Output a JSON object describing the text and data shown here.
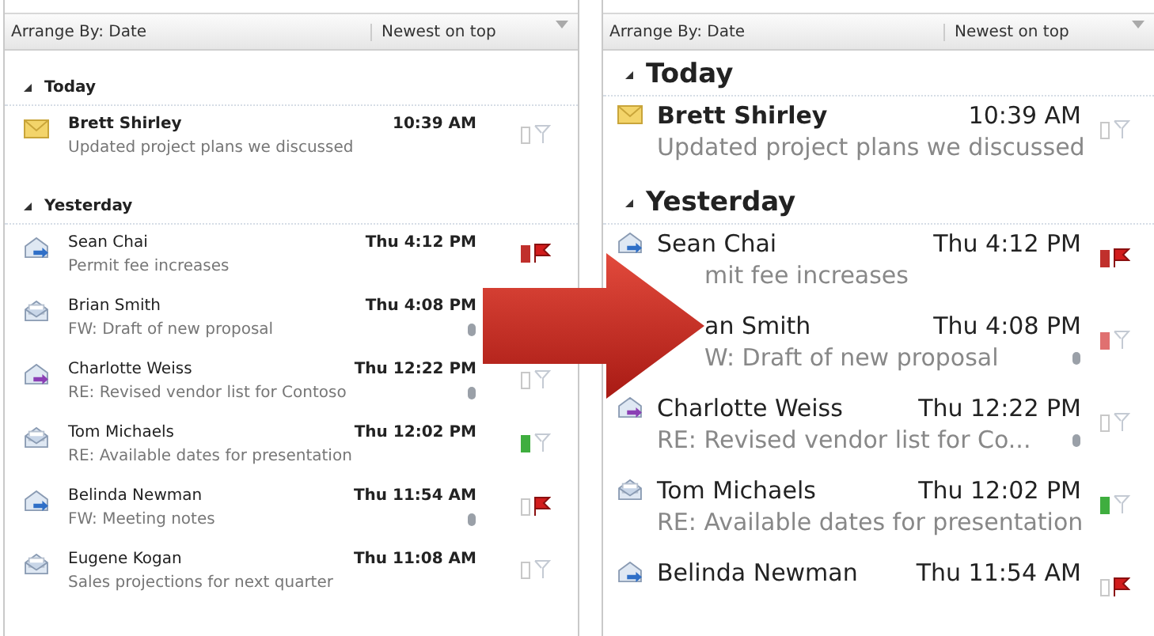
{
  "panels": [
    {
      "kind": "small",
      "header": {
        "arrange": "Arrange By: Date",
        "order": "Newest on top"
      },
      "groups": [
        {
          "label": "Today",
          "messages": [
            {
              "kind": "unread",
              "from": "Brett Shirley",
              "time": "10:39 AM",
              "subject": "Updated project plans we discussed",
              "unread": true,
              "flagged": false
            }
          ]
        },
        {
          "label": "Yesterday",
          "messages": [
            {
              "kind": "replied",
              "from": "Sean Chai",
              "time": "Thu 4:12 PM",
              "subject": "Permit fee increases",
              "unread": false,
              "color": "#c0302c",
              "flagged": true
            },
            {
              "kind": "read",
              "from": "Brian Smith",
              "time": "Thu 4:08 PM",
              "subject": "FW: Draft of new proposal",
              "unread": false,
              "attachment": true
            },
            {
              "kind": "forwarded",
              "from": "Charlotte Weiss",
              "time": "Thu 12:22 PM",
              "subject": "RE: Revised vendor list for Contoso",
              "unread": false,
              "attachment": true,
              "flagged": false
            },
            {
              "kind": "read",
              "from": "Tom Michaels",
              "time": "Thu 12:02 PM",
              "subject": "RE: Available dates for presentation",
              "unread": false,
              "color": "#3fae3f",
              "flagged": false
            },
            {
              "kind": "replied",
              "from": "Belinda Newman",
              "time": "Thu 11:54 AM",
              "subject": "FW: Meeting notes",
              "unread": false,
              "attachment": true,
              "flagged": true
            },
            {
              "kind": "read",
              "from": "Eugene Kogan",
              "time": "Thu 11:08 AM",
              "subject": "Sales projections for next quarter",
              "unread": false,
              "flagged": false
            }
          ]
        }
      ]
    },
    {
      "kind": "large",
      "header": {
        "arrange": "Arrange By: Date",
        "order": "Newest on top"
      },
      "groups": [
        {
          "label": "Today",
          "messages": [
            {
              "kind": "unread",
              "from": "Brett Shirley",
              "time": "10:39 AM",
              "subject": "Updated project plans we discussed",
              "unread": true,
              "flagged": false
            }
          ]
        },
        {
          "label": "Yesterday",
          "messages": [
            {
              "kind": "replied",
              "from": "Sean Chai",
              "time": "Thu 4:12 PM",
              "subject": "mit fee increases",
              "subject_hidden_start": true,
              "unread": false,
              "color": "#c0302c",
              "flagged": true
            },
            {
              "kind": "hidden",
              "from": "an Smith",
              "from_hidden_start": true,
              "time": "Thu 4:08 PM",
              "subject": "W: Draft of new proposal",
              "subject_hidden_start": true,
              "unread": false,
              "attachment": true,
              "color": "#e07070",
              "flagged": false
            },
            {
              "kind": "forwarded",
              "from": "Charlotte Weiss",
              "time": "Thu 12:22 PM",
              "subject": "RE: Revised vendor list for Co...",
              "unread": false,
              "attachment": true,
              "flagged": false
            },
            {
              "kind": "read",
              "from": "Tom Michaels",
              "time": "Thu 12:02 PM",
              "subject": "RE: Available dates for presentation",
              "unread": false,
              "color": "#3fae3f",
              "flagged": false
            },
            {
              "kind": "replied",
              "from": "Belinda Newman",
              "time": "Thu 11:54 AM",
              "unread": false,
              "flagged": true
            }
          ]
        }
      ]
    }
  ]
}
